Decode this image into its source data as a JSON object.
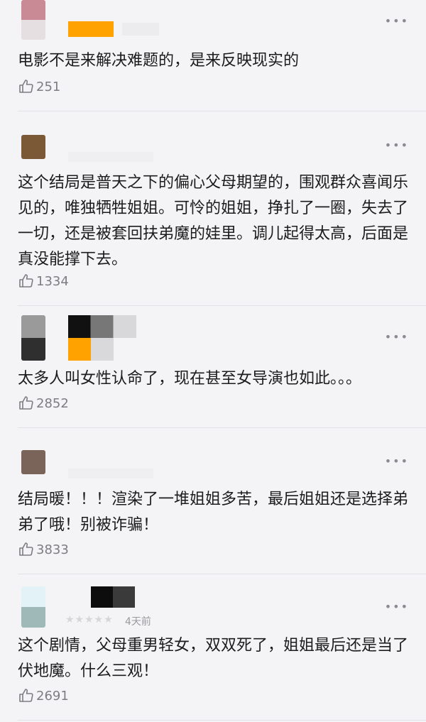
{
  "comments": [
    {
      "text": "电影不是来解决难题的，是来反映现实的",
      "likes": "251",
      "time": ""
    },
    {
      "text": "这个结局是普天之下的偏心父母期望的，围观群众喜闻乐见的，唯独牺牲姐姐。可怜的姐姐，挣扎了一圈，失去了一切，还是被套回扶弟魔的娃里。调儿起得太高，后面是真没能撑下去。",
      "likes": "1334",
      "time": ""
    },
    {
      "text": "太多人叫女性认命了，现在甚至女导演也如此。。。",
      "likes": "2852",
      "time": ""
    },
    {
      "text": "结局暖！！！渲染了一堆姐姐多苦，最后姐姐还是选择弟弟了哦！别被诈骗！",
      "likes": "3833",
      "time": ""
    },
    {
      "text": "这个剧情，父母重男轻女，双双死了，姐姐最后还是当了伏地魔。什么三观！",
      "likes": "2691",
      "time": "4天前",
      "stars": "★★★★★"
    }
  ],
  "icons": {
    "like": "thumbs-up-icon",
    "more": "more-dots-icon"
  },
  "colors": {
    "background": "#f4f4f6",
    "text": "#1c1c1e",
    "secondary": "#7d7d82",
    "accent_orange": "#ffa200"
  }
}
